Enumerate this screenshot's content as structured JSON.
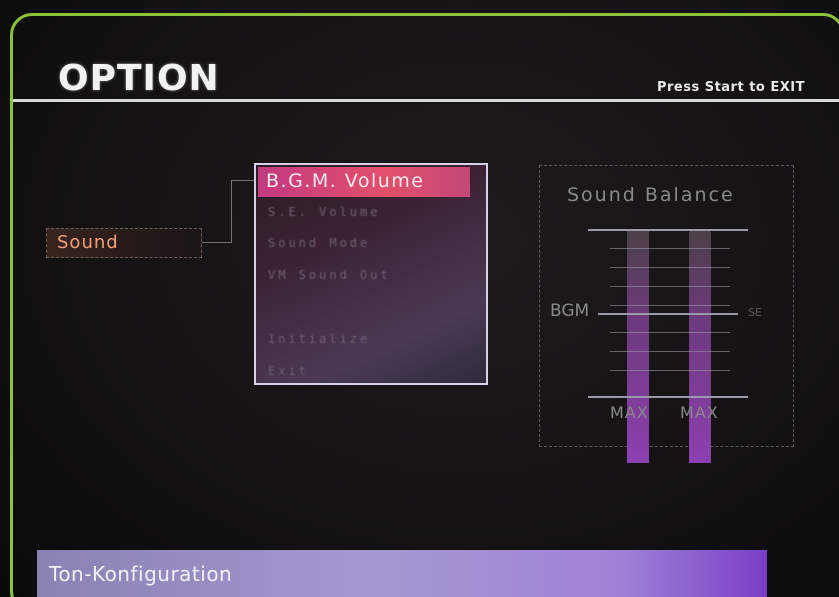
{
  "header": {
    "title": "OPTION",
    "exit_hint": "Press Start to EXIT"
  },
  "categories": {
    "items": [
      {
        "label": "",
        "state": "unreadable"
      },
      {
        "label": "",
        "state": "unreadable"
      },
      {
        "label": "Sound",
        "state": "selected"
      },
      {
        "label": "",
        "state": "unreadable"
      },
      {
        "label": "",
        "state": "unreadable"
      }
    ]
  },
  "submenu": {
    "items": [
      {
        "label": "B.G.M. Volume",
        "selected": true
      },
      {
        "label": "S.E. Volume",
        "selected": false
      },
      {
        "label": "Sound Mode",
        "selected": false
      },
      {
        "label": "VM Sound Out",
        "selected": false
      },
      {
        "label": "Initialize",
        "selected": false
      },
      {
        "label": "Exit",
        "selected": false
      }
    ]
  },
  "balance": {
    "title": "Sound Balance",
    "left_label": "BGM",
    "right_label": "SE",
    "bar_left_bottom_label": "MAX",
    "bar_right_bottom_label": "MAX",
    "bgm_level": 1.0,
    "se_level": 1.0
  },
  "footer": {
    "text": "Ton-Konfiguration"
  },
  "colors": {
    "frame": "#8ec23a",
    "selected_category_text": "#f2a07a",
    "selected_submenu_bg": "#e2506a",
    "footer_bg": "#a598d0",
    "bar_fill": "#8e3fb0"
  }
}
